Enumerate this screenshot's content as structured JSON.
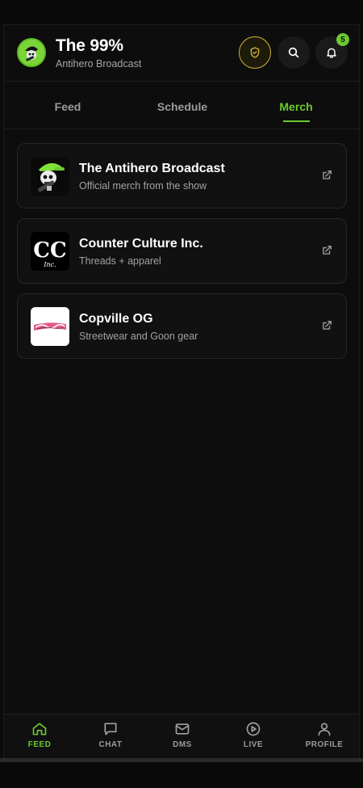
{
  "header": {
    "title": "The 99%",
    "subtitle": "Antihero Broadcast",
    "notification_count": "5"
  },
  "tabs": [
    {
      "label": "Feed",
      "active": false
    },
    {
      "label": "Schedule",
      "active": false
    },
    {
      "label": "Merch",
      "active": true
    }
  ],
  "merch": [
    {
      "name": "The Antihero Broadcast",
      "desc": "Official merch from the show",
      "logo": "skull-mascot-logo"
    },
    {
      "name": "Counter Culture Inc.",
      "desc": "Threads + apparel",
      "logo": "cc-blackletter-logo"
    },
    {
      "name": "Copville OG",
      "desc": "Streetwear and Goon gear",
      "logo": "copville-script-logo"
    }
  ],
  "logo_lettering": {
    "counter_culture": "CC",
    "counter_culture_sub": "Inc."
  },
  "bottom_nav": [
    {
      "label": "FEED",
      "icon": "home-icon",
      "active": true
    },
    {
      "label": "CHAT",
      "icon": "chat-icon",
      "active": false
    },
    {
      "label": "DMS",
      "icon": "mail-icon",
      "active": false
    },
    {
      "label": "LIVE",
      "icon": "play-icon",
      "active": false
    },
    {
      "label": "PROFILE",
      "icon": "user-icon",
      "active": false
    }
  ],
  "colors": {
    "accent": "#6cc832",
    "gold": "#d4b43a",
    "background": "#0d0d0d",
    "card": "#111111"
  }
}
